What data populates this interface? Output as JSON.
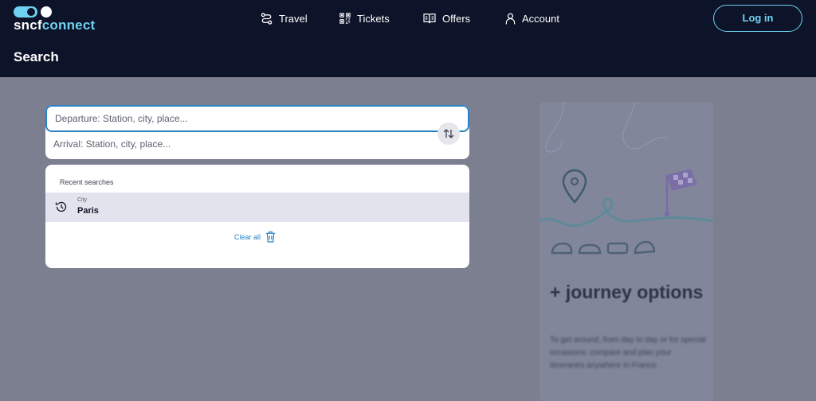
{
  "header": {
    "logo": {
      "prefix": "sncf",
      "suffix": "connect"
    },
    "nav": [
      {
        "label": "Travel",
        "icon": "route-icon"
      },
      {
        "label": "Tickets",
        "icon": "qr-code-icon"
      },
      {
        "label": "Offers",
        "icon": "book-icon"
      },
      {
        "label": "Account",
        "icon": "user-icon"
      }
    ],
    "login_label": "Log in"
  },
  "page": {
    "title": "Search"
  },
  "search": {
    "departure_placeholder": "Departure: Station, city, place...",
    "departure_value": "",
    "arrival_placeholder": "Arrival: Station, city, place...",
    "arrival_value": "",
    "swap_icon": "swap-arrows-icon"
  },
  "recent": {
    "heading": "Recent searches",
    "items": [
      {
        "type": "City",
        "name": "Paris",
        "icon": "history-icon"
      }
    ],
    "clear_label": "Clear all",
    "clear_icon": "trash-icon"
  },
  "promo": {
    "title": "+ journey options",
    "text": "To get around, from day to day or for special occasions: compare and plan your itineraries anywhere in France"
  },
  "colors": {
    "header_bg": "#0d1328",
    "accent": "#6fd2f0",
    "link": "#2a82c4",
    "overlay_bg": "#7b7f90",
    "selected_row": "#e2e3ec"
  }
}
